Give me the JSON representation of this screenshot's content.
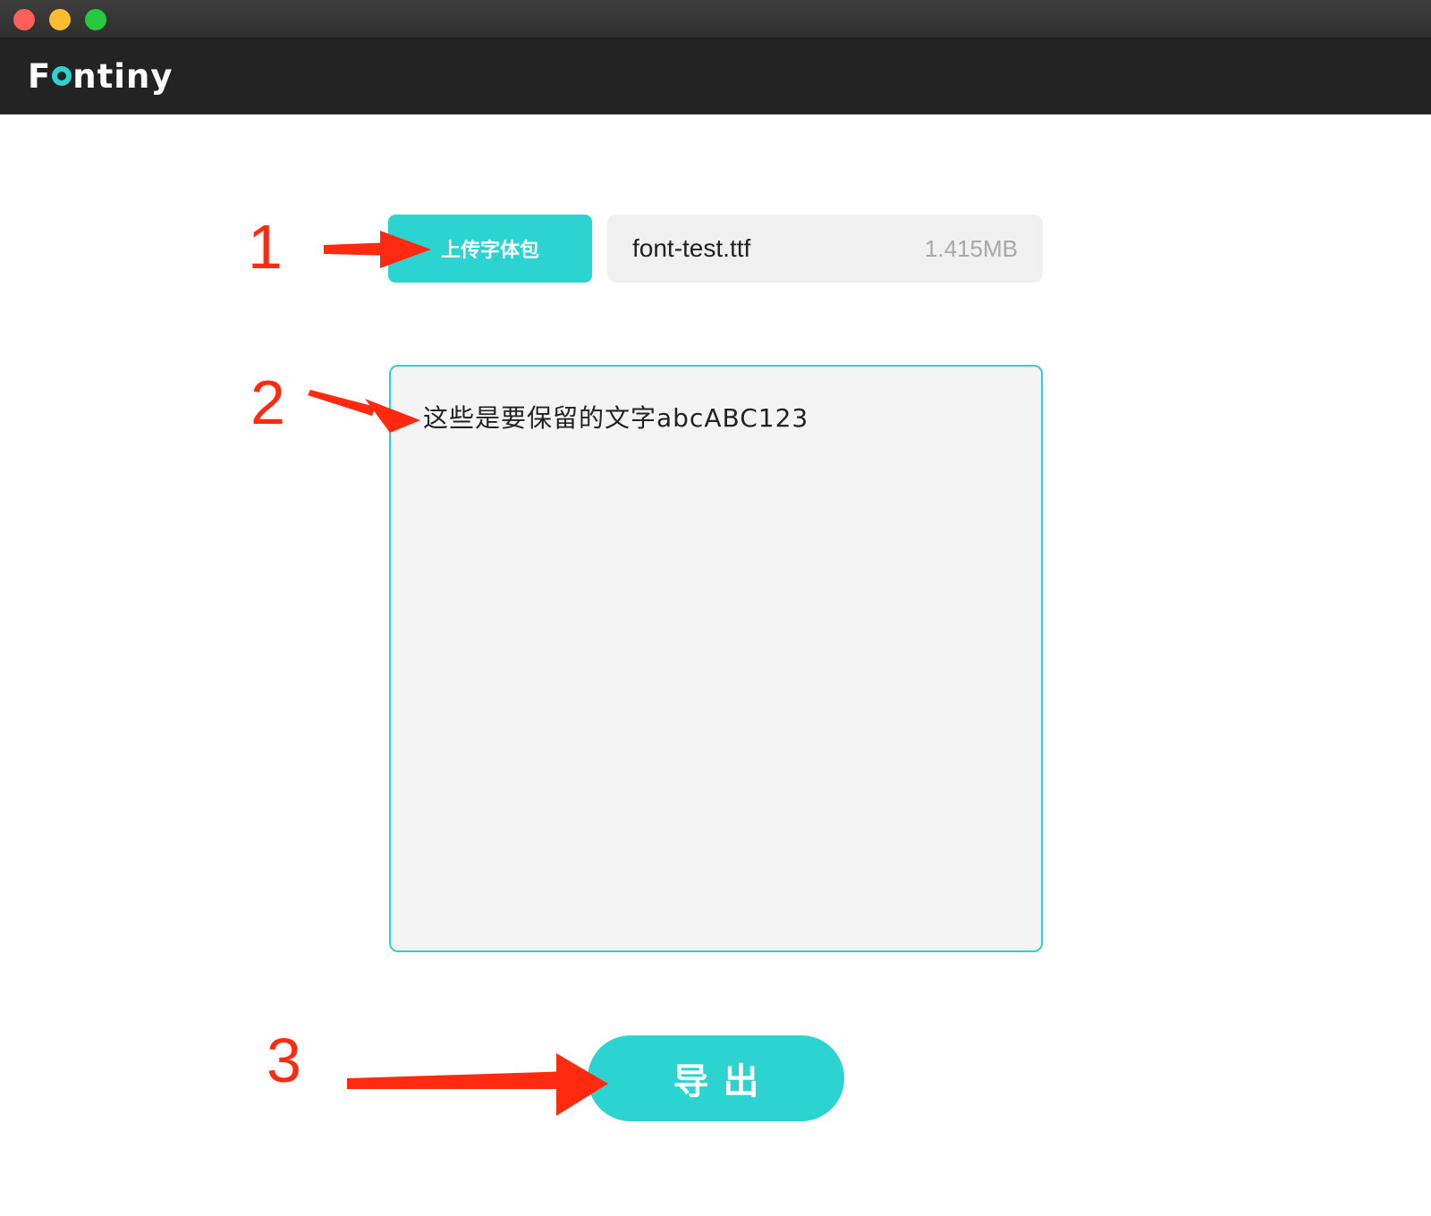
{
  "app": {
    "logo_text_prefix": "F",
    "logo_text_suffix": "ntiny"
  },
  "steps": {
    "step1": "1",
    "step2": "2",
    "step3": "3"
  },
  "upload": {
    "button_label": "上传字体包",
    "file_name": "font-test.ttf",
    "file_size": "1.415MB"
  },
  "editor": {
    "text": "这些是要保留的文字abcABC123"
  },
  "export": {
    "button_label": "导出"
  },
  "colors": {
    "accent": "#2bd4d1",
    "annotation": "#ff2a10",
    "header_bg": "#232323"
  },
  "icons": {
    "window_controls": [
      "close-icon",
      "minimize-icon",
      "maximize-icon"
    ],
    "annotations": [
      "arrow-icon"
    ]
  }
}
